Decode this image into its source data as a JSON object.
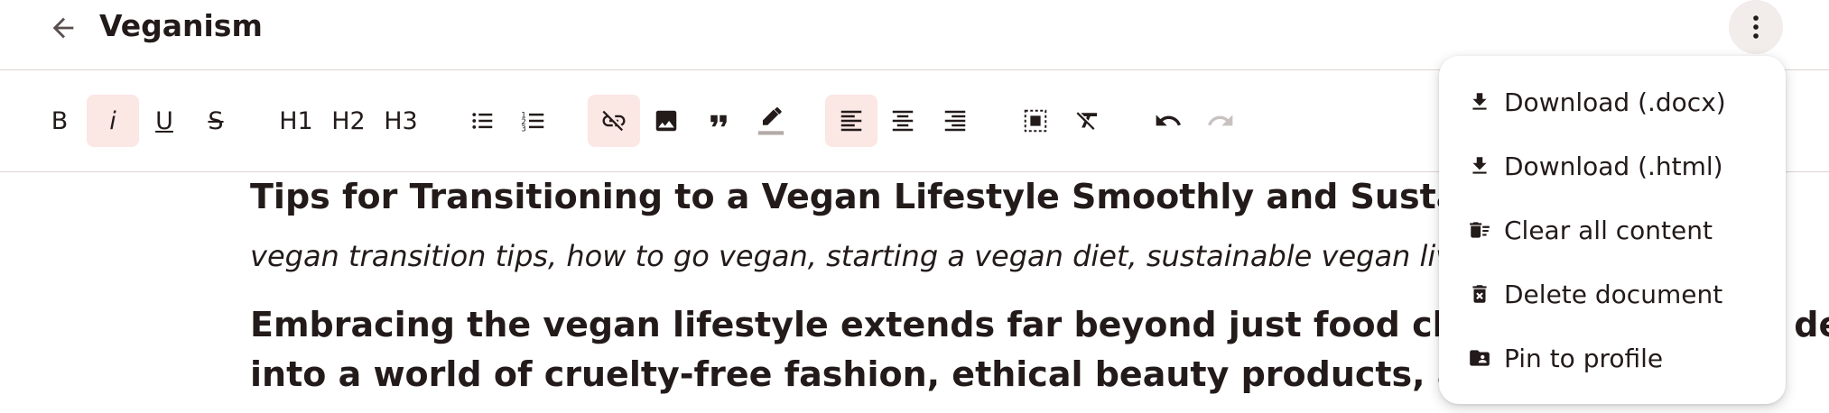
{
  "header": {
    "title": "Veganism",
    "back_icon": "arrow-back-icon",
    "more_icon": "more-vert-icon"
  },
  "toolbar": {
    "bold_label": "B",
    "italic_label": "i",
    "underline_label": "U",
    "strike_label": "S",
    "h1_label": "H1",
    "h2_label": "H2",
    "h3_label": "H3",
    "icons": [
      "bullet-list-icon",
      "numbered-list-icon",
      "link-off-icon",
      "image-icon",
      "quote-icon",
      "highlight-icon",
      "align-left-icon",
      "align-center-icon",
      "align-right-icon",
      "select-all-icon",
      "clear-format-icon",
      "undo-icon",
      "redo-icon"
    ],
    "active_items": [
      "italic",
      "link-off",
      "align-left"
    ],
    "disabled_items": [
      "redo"
    ]
  },
  "editor": {
    "heading": "Tips for Transitioning to a Vegan Lifestyle Smoothly and Sustainably",
    "keywords": "vegan transition tips, how to go vegan, starting a vegan diet, sustainable vegan living",
    "paragraph": "Embracing the vegan lifestyle extends far beyond just food choices. It involves delving into a world of cruelty-free fashion, ethical beauty products, and"
  },
  "menu": {
    "items": [
      {
        "label": "Download (.docx)",
        "icon": "download-icon"
      },
      {
        "label": "Download (.html)",
        "icon": "download-icon"
      },
      {
        "label": "Clear all content",
        "icon": "delete-sweep-icon"
      },
      {
        "label": "Delete document",
        "icon": "delete-forever-icon"
      },
      {
        "label": "Pin to profile",
        "icon": "folder-account-icon"
      }
    ]
  },
  "colors": {
    "text": "#231a1a",
    "active_bg": "#fbe7e4",
    "divider": "#ddd3d1",
    "disabled": "#c9c2c1",
    "more_button_bg": "#f2eceb"
  }
}
